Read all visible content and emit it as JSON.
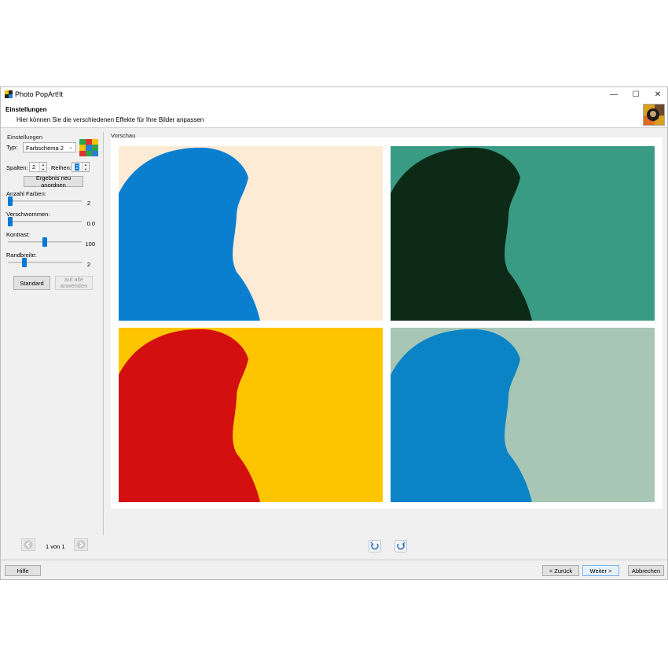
{
  "window": {
    "title": "Photo PopArt!It"
  },
  "header": {
    "title": "Einstellungen",
    "subtitle": "Hier können Sie die verschiedenen Effekte für Ihre Bilder anpassen"
  },
  "settings": {
    "group_label": "Einstellungen",
    "type_label": "Typ:",
    "type_value": "Farbschema 2",
    "columns_label": "Spalten:",
    "columns_value": "2",
    "rows_label": "Reihen:",
    "rows_value": "2",
    "rearrange_button": "Ergebnis neu anordnen",
    "colors_label": "Anzahl Farben:",
    "colors_value": "2",
    "colors_level": 0.0,
    "blur_label": "Verschwommen:",
    "blur_value": "0.0",
    "blur_level": 0.0,
    "contrast_label": "Kontrast:",
    "contrast_value": "100",
    "contrast_level": 0.5,
    "border_label": "Randbreite:",
    "border_value": "2",
    "border_level": 0.2,
    "standard_button": "Standard",
    "apply_all_button_line1": "auf alle",
    "apply_all_button_line2": "anwenden"
  },
  "pagination": {
    "text": "1 von 1"
  },
  "preview": {
    "group_label": "Vorschau",
    "tiles": [
      {
        "background": "#fdebd6",
        "ink": "#0a7fd0"
      },
      {
        "background": "#3a9b85",
        "ink": "#0d2a16"
      },
      {
        "background": "#fdc500",
        "ink": "#d30f0f"
      },
      {
        "background": "#a7c6b5",
        "ink": "#0a84c6"
      }
    ]
  },
  "footer": {
    "help_button": "Hilfe",
    "back_button": "< Zurück",
    "next_button": "Weiter >",
    "cancel_button": "Abbrechen"
  },
  "colors": {
    "accent": "#0078d7"
  }
}
